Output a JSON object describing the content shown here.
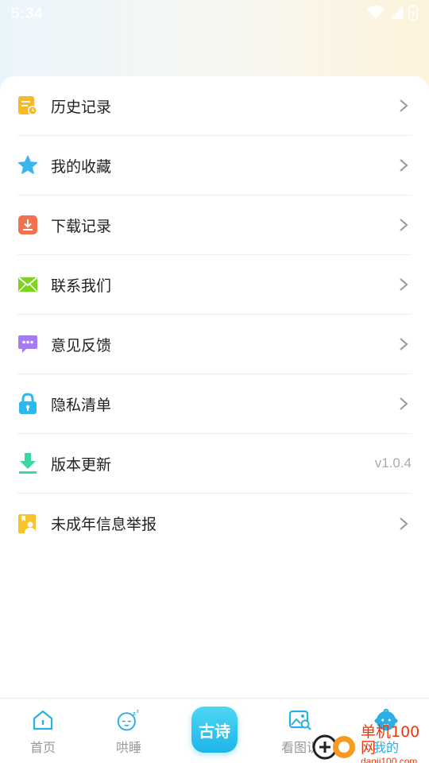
{
  "status_bar": {
    "time": "5:34",
    "icons": [
      "wifi-icon",
      "signal-icon",
      "battery-icon"
    ]
  },
  "menu": {
    "items": [
      {
        "label": "历史记录",
        "icon": "history-icon",
        "icon_color": "#f7b928",
        "trailing": "chevron"
      },
      {
        "label": "我的收藏",
        "icon": "star-icon",
        "icon_color": "#3ab5f0",
        "trailing": "chevron"
      },
      {
        "label": "下载记录",
        "icon": "download-record-icon",
        "icon_color": "#f2724f",
        "trailing": "chevron"
      },
      {
        "label": "联系我们",
        "icon": "mail-icon",
        "icon_color": "#7ed321",
        "trailing": "chevron"
      },
      {
        "label": "意见反馈",
        "icon": "feedback-icon",
        "icon_color": "#a57cf0",
        "trailing": "chevron"
      },
      {
        "label": "隐私清单",
        "icon": "lock-icon",
        "icon_color": "#2cb8f0",
        "trailing": "chevron"
      },
      {
        "label": "版本更新",
        "icon": "update-icon",
        "icon_color": "#3fd6a6",
        "trailing": "version",
        "version": "v1.0.4"
      },
      {
        "label": "未成年信息举报",
        "icon": "report-icon",
        "icon_color": "#f7c32b",
        "trailing": "chevron"
      }
    ]
  },
  "bottom_nav": {
    "items": [
      {
        "label": "首页",
        "icon": "home-icon"
      },
      {
        "label": "哄睡",
        "icon": "sleep-face-icon"
      },
      {
        "label": "古诗",
        "icon": "poem-center-button"
      },
      {
        "label": "看图识",
        "icon": "picture-search-icon"
      },
      {
        "label": "我的",
        "icon": "baby-avatar-icon",
        "active": true
      }
    ]
  },
  "watermark": {
    "title": "单机100网",
    "subtitle": "danji100.com"
  },
  "colors": {
    "accent": "#2aaee6",
    "text_primary": "#222222",
    "text_secondary": "#999999",
    "divider": "#eeeeee"
  }
}
